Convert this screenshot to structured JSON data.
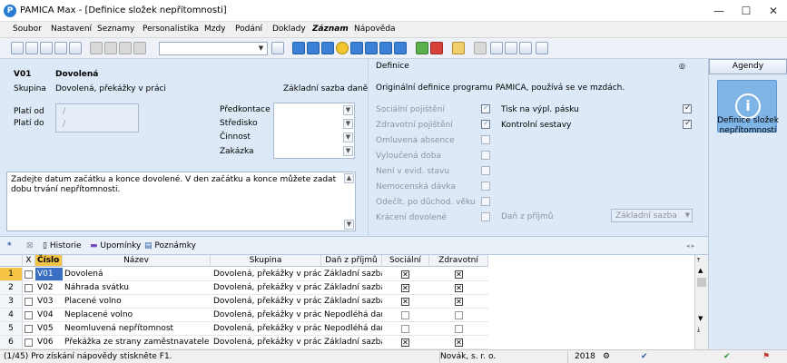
{
  "window": {
    "title": "PAMICA Max - [Definice složek nepřítomnosti]",
    "app_icon": "P"
  },
  "menu": [
    "Soubor",
    "Nastavení",
    "Seznamy",
    "Personalistika",
    "Mzdy",
    "Podání",
    "Doklady",
    "Záznam",
    "Nápověda"
  ],
  "detail": {
    "code": "V01",
    "name": "Dovolená",
    "group_label": "Skupina",
    "group_value": "Dovolená, překážky v práci",
    "base_label": "Základní sazba daně",
    "valid_from_label": "Platí od",
    "valid_to_label": "Platí do",
    "valid_from_value": "/",
    "valid_to_value": "/",
    "predkontace": "Předkontace",
    "stredisko": "Středisko",
    "cinnost": "Činnost",
    "zakazka": "Zakázka",
    "note": "Zadejte datum začátku a konce dovolené. V den začátku a konce můžete zadat dobu trvání nepřítomnosti."
  },
  "definice": {
    "header": "Definice",
    "description": "Originální definice programu PAMICA, používá se ve mzdách.",
    "checks_left": [
      {
        "label": "Sociální pojištění",
        "checked": true
      },
      {
        "label": "Zdravotní pojištění",
        "checked": true
      },
      {
        "label": "Omluvená absence",
        "checked": false
      },
      {
        "label": "Vyloučená doba",
        "checked": false
      },
      {
        "label": "Není v evid. stavu",
        "checked": false
      },
      {
        "label": "Nemocenská dávka",
        "checked": false
      },
      {
        "label": "Odečít. po důchod. věku",
        "checked": false
      },
      {
        "label": "Krácení dovolené",
        "checked": false
      }
    ],
    "tisk_label": "Tisk na výpl. pásku",
    "kontrolni_label": "Kontrolní sestavy",
    "dan_label": "Daň z příjmů",
    "dan_value": "Základní sazba"
  },
  "agenda": {
    "title": "Agendy",
    "item": "Definice složek nepřítomnosti"
  },
  "tabs": {
    "star": "*",
    "historie": "Historie",
    "upominky": "Upomínky",
    "poznamky": "Poznámky"
  },
  "grid": {
    "columns": {
      "x": "X",
      "cislo": "Číslo",
      "nazev": "Název",
      "skupina": "Skupina",
      "dan": "Daň z příjmů",
      "socialni": "Sociální",
      "zdravotni": "Zdravotní"
    },
    "rows": [
      {
        "n": "1",
        "code": "V01",
        "name": "Dovolená",
        "group": "Dovolená, překážky v práci",
        "tax": "Základní sazba",
        "soc": true,
        "zdr": true
      },
      {
        "n": "2",
        "code": "V02",
        "name": "Náhrada svátku",
        "group": "Dovolená, překážky v práci",
        "tax": "Základní sazba",
        "soc": true,
        "zdr": true
      },
      {
        "n": "3",
        "code": "V03",
        "name": "Placené volno",
        "group": "Dovolená, překážky v práci",
        "tax": "Základní sazba",
        "soc": true,
        "zdr": true
      },
      {
        "n": "4",
        "code": "V04",
        "name": "Neplacené volno",
        "group": "Dovolená, překážky v práci",
        "tax": "Nepodléhá dani",
        "soc": false,
        "zdr": false
      },
      {
        "n": "5",
        "code": "V05",
        "name": "Neomluvená nepřítomnost",
        "group": "Dovolená, překážky v práci",
        "tax": "Nepodléhá dani",
        "soc": false,
        "zdr": false
      },
      {
        "n": "6",
        "code": "V06",
        "name": "Překážka ze strany zaměstnavatele",
        "group": "Dovolená, překážky v práci",
        "tax": "Základní sazba",
        "soc": true,
        "zdr": true
      }
    ]
  },
  "status": {
    "hint": "(1/45) Pro získání nápovědy stiskněte F1.",
    "company": "Novák, s. r. o.",
    "year": "2018"
  }
}
